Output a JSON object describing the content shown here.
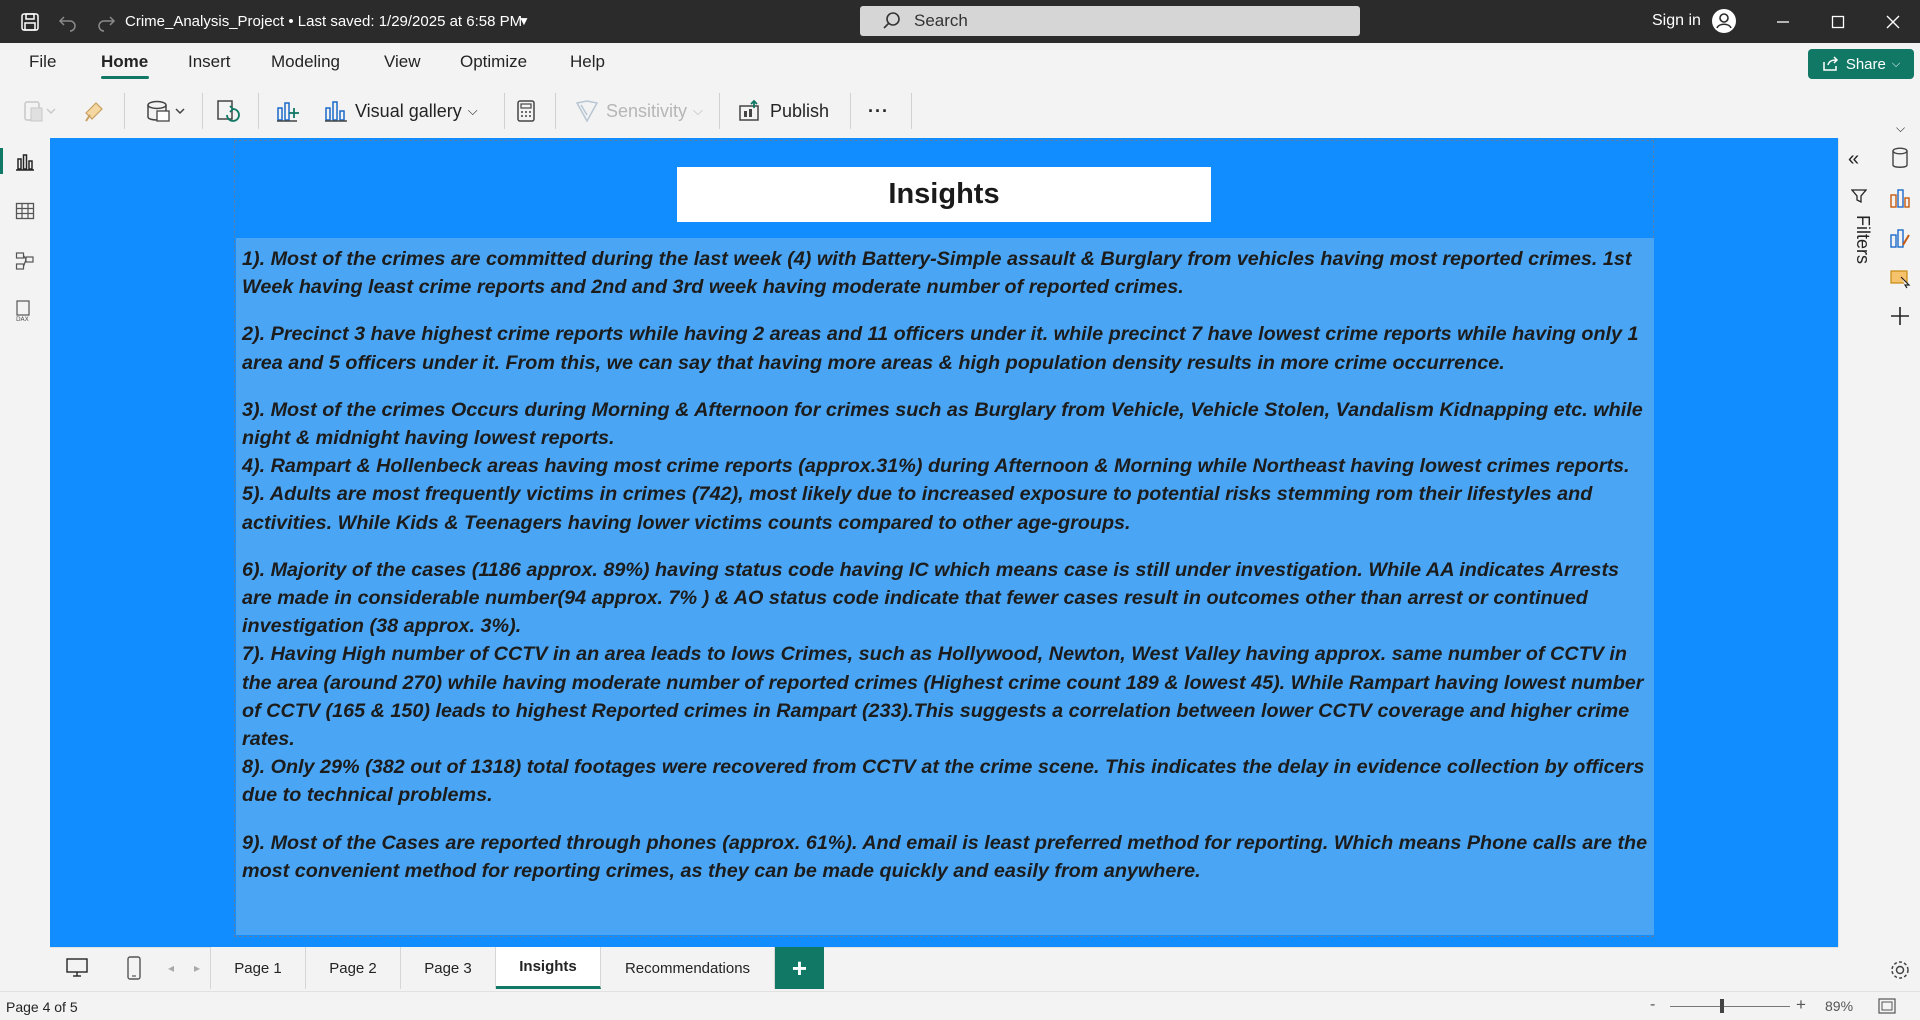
{
  "titlebar": {
    "doc_title": "Crime_Analysis_Project • Last saved: 1/29/2025 at 6:58 PM",
    "search_placeholder": "Search",
    "sign_in": "Sign in"
  },
  "menu": {
    "items": [
      "File",
      "Home",
      "Insert",
      "Modeling",
      "View",
      "Optimize",
      "Help"
    ],
    "active": "Home",
    "share_label": "Share"
  },
  "ribbon": {
    "visual_gallery": "Visual gallery",
    "sensitivity": "Sensitivity",
    "publish": "Publish",
    "more": "···"
  },
  "report": {
    "title": "Insights",
    "paragraphs": [
      "1). Most of the crimes are committed during the last week (4) with Battery-Simple assault & Burglary from vehicles having most reported crimes. 1st Week having least crime reports and 2nd and 3rd week having moderate number of reported crimes.",
      "2). Precinct 3 have highest crime reports while having 2 areas and 11 officers under it. while precinct 7 have lowest crime reports while having only 1 area and 5 officers under it. From this, we can say that having more areas & high population density results in more crime occurrence.",
      "3). Most of the crimes Occurs during Morning & Afternoon for crimes such as Burglary from Vehicle, Vehicle Stolen, Vandalism Kidnapping etc. while night & midnight having lowest reports.",
      "4). Rampart & Hollenbeck areas having most crime reports (approx.31%) during Afternoon & Morning while Northeast having lowest crimes reports.",
      "5). Adults are most frequently victims in crimes (742), most likely due to increased exposure to potential risks stemming  rom their lifestyles and activities. While Kids & Teenagers having lower victims counts compared to other age-groups.",
      "6). Majority of the cases (1186 approx. 89%) having status code having IC which means case is still under investigation. While AA indicates Arrests are made in considerable number(94 approx. 7% ) & AO status code indicate that fewer cases result in outcomes other than arrest or continued investigation (38 approx. 3%).",
      "7). Having High number of CCTV in an area leads to lows Crimes, such as Hollywood, Newton, West Valley having approx. same number of CCTV in the area (around 270) while having moderate number of reported crimes (Highest crime count  189 & lowest 45). While  Rampart having lowest number of CCTV (165 & 150) leads to highest Reported crimes in Rampart (233).This suggests a correlation between lower CCTV coverage and higher crime rates.",
      "8). Only  29% (382 out of 1318) total footages were recovered from CCTV at the crime scene. This indicates the delay in evidence collection by officers due to technical problems.",
      "9). Most of the Cases are reported through phones (approx. 61%). And email is least preferred method for reporting. Which means Phone calls are the most convenient method for reporting crimes, as they can be made quickly and easily from anywhere."
    ]
  },
  "filters_label": "Filters",
  "pages": {
    "tabs": [
      "Page 1",
      "Page 2",
      "Page 3",
      "Insights",
      "Recommendations"
    ],
    "active": "Insights",
    "add_label": "+"
  },
  "status": {
    "page_indicator": "Page 4 of 5",
    "zoom_minus": "-",
    "zoom_plus": "+",
    "zoom": "89%"
  },
  "colors": {
    "accent": "#117865",
    "canvas": "#118dff",
    "textbox": "#4aa6f5",
    "titlebar": "#2b2b2b"
  }
}
